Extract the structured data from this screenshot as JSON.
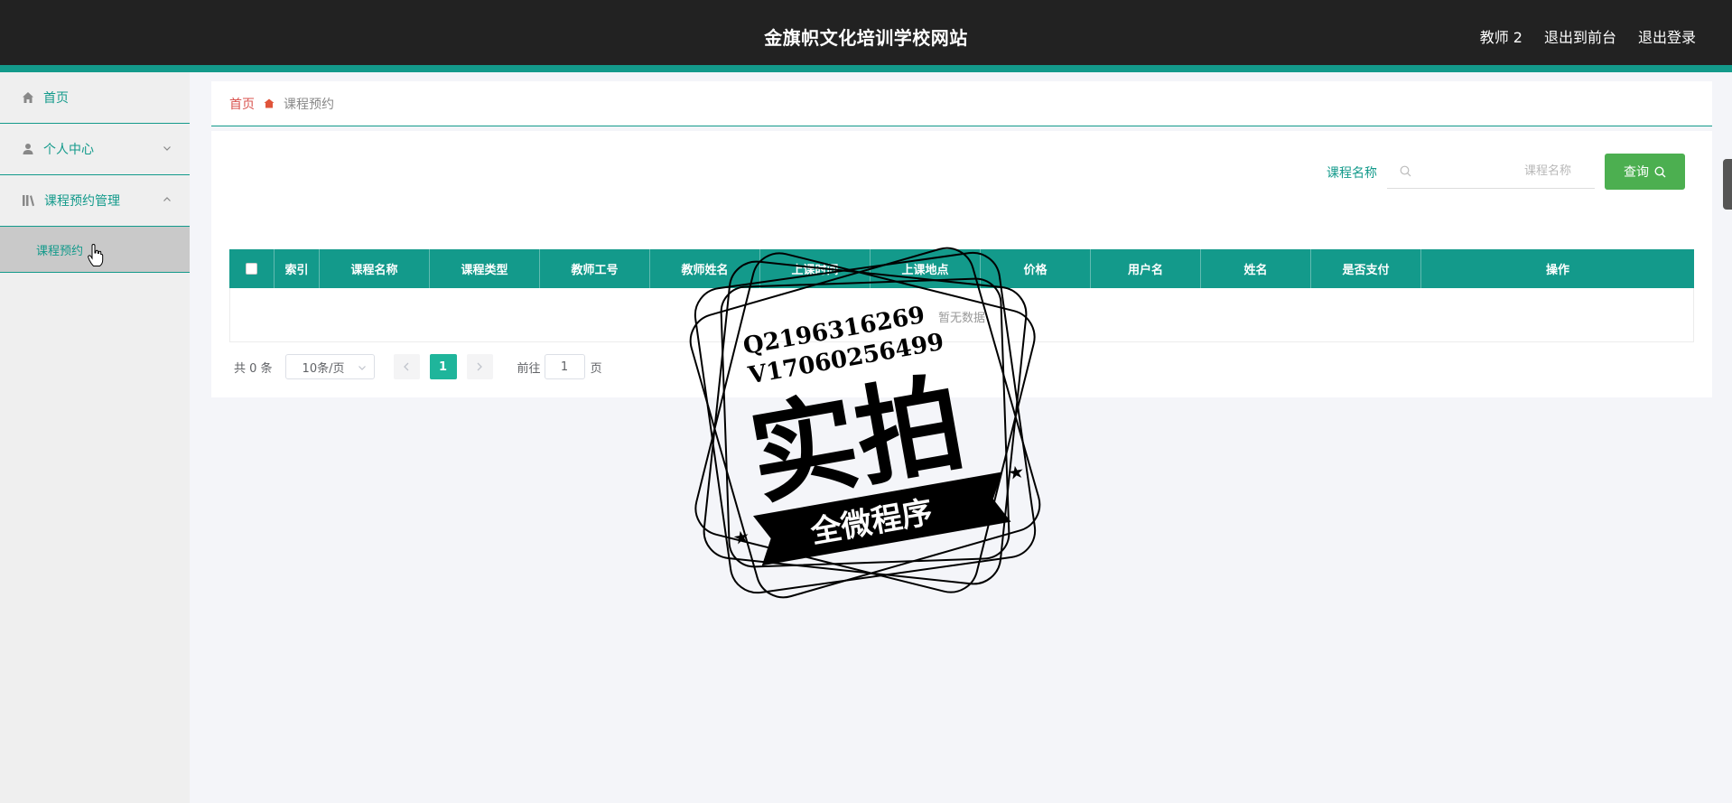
{
  "header": {
    "site_title": "金旗帜文化培训学校网站",
    "user": "教师 2",
    "to_front": "退出到前台",
    "logout": "退出登录"
  },
  "sidebar": {
    "items": [
      {
        "label": "首页",
        "icon": "home-icon"
      },
      {
        "label": "个人中心",
        "icon": "user-icon"
      },
      {
        "label": "课程预约管理",
        "icon": "library-icon"
      }
    ],
    "sub_item": "课程预约"
  },
  "breadcrumb": {
    "home": "首页",
    "current": "课程预约"
  },
  "search": {
    "label": "课程名称",
    "placeholder": "课程名称",
    "button": "查询"
  },
  "table": {
    "columns": [
      "索引",
      "课程名称",
      "课程类型",
      "教师工号",
      "教师姓名",
      "上课时间",
      "上课地点",
      "价格",
      "用户名",
      "姓名",
      "是否支付",
      "操作"
    ],
    "empty_text": "暂无数据"
  },
  "pagination": {
    "total": "共 0 条",
    "page_size": "10条/页",
    "current_page": "1",
    "goto_prefix": "前往",
    "goto_value": "1",
    "goto_suffix": "页"
  },
  "watermark": {
    "line1": "Q2196316269",
    "line2": "V17060256499",
    "main": "实拍",
    "banner": "全微程序"
  },
  "colors": {
    "accent": "#139a8b",
    "header_bg": "#222222",
    "search_button": "#4caf50",
    "page_active": "#1fb59b"
  }
}
